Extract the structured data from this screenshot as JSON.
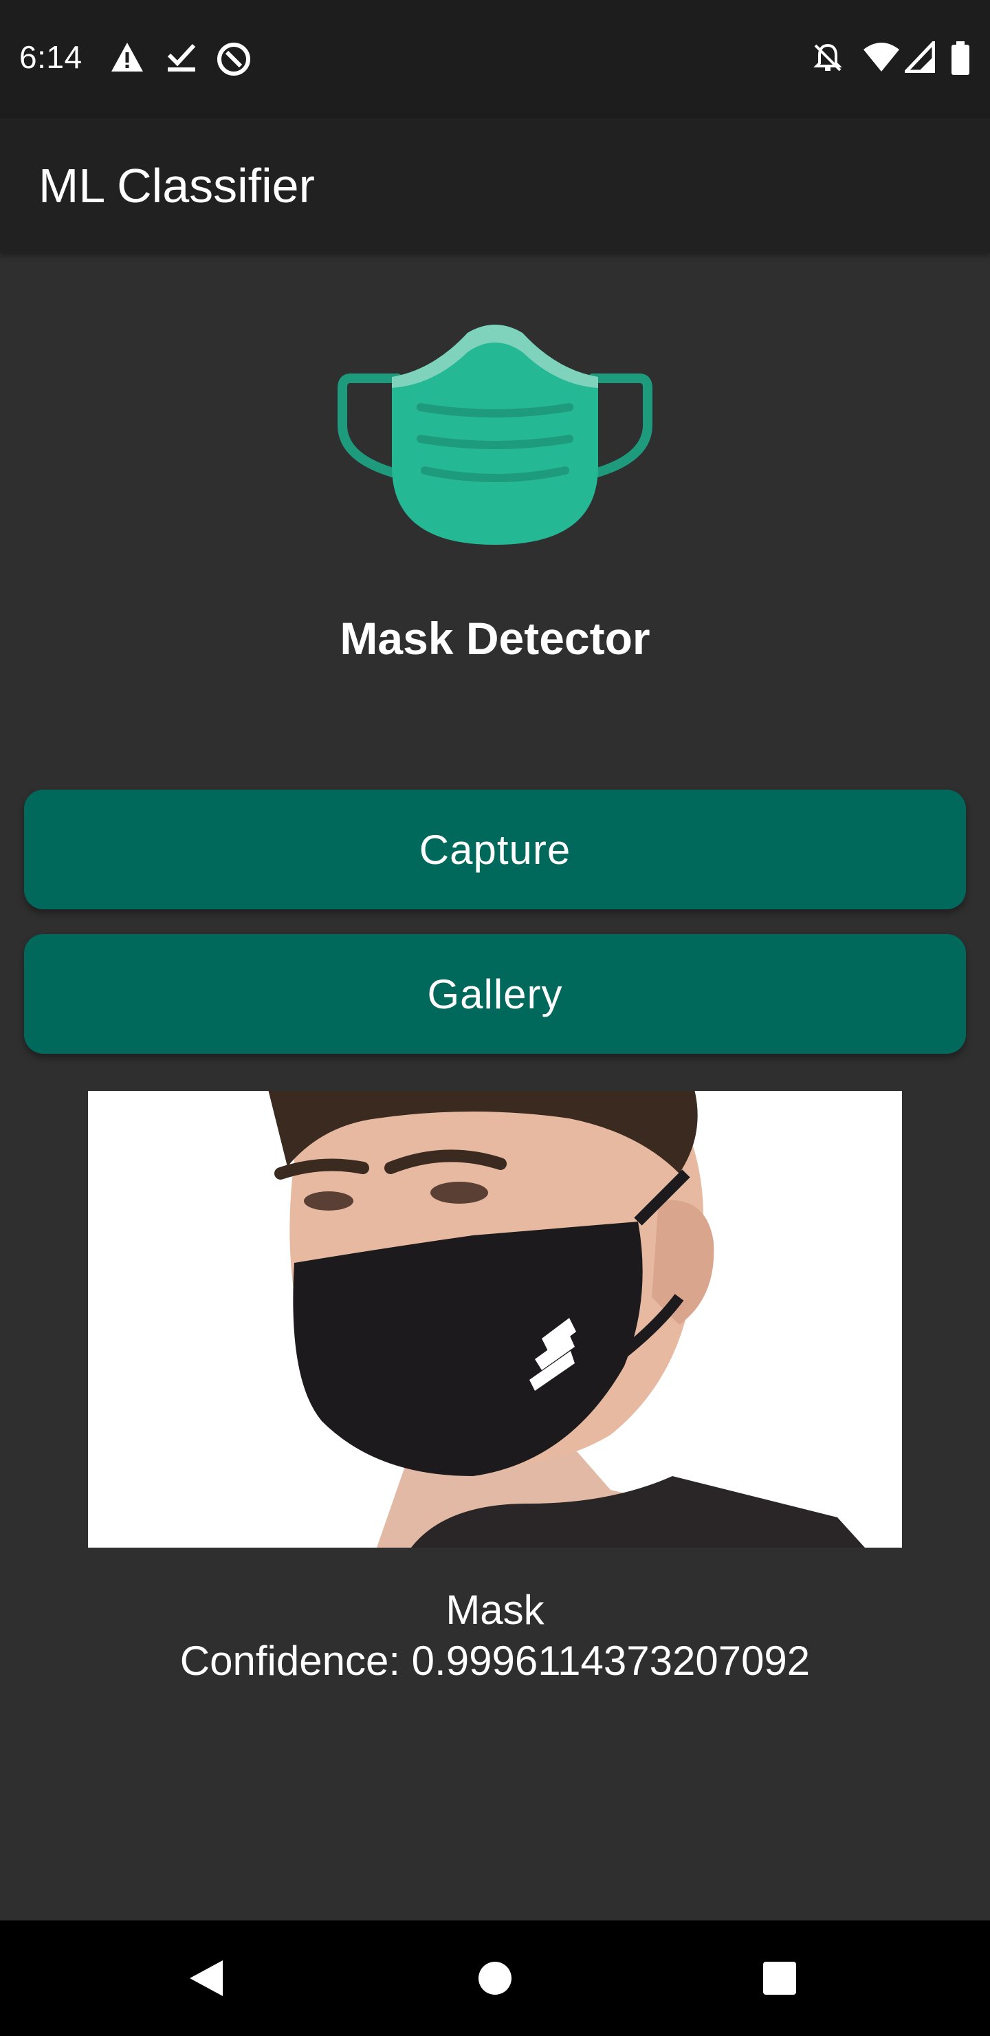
{
  "status_bar": {
    "time": "6:14",
    "left_icons": [
      "warning-icon",
      "check-icon",
      "data-saver-icon"
    ],
    "right_icons": [
      "notifications-off-icon",
      "wifi-icon",
      "signal-icon",
      "battery-icon"
    ]
  },
  "app_bar": {
    "title": "ML Classifier"
  },
  "main": {
    "logo_icon": "face-mask-icon",
    "heading": "Mask Detector",
    "capture_label": "Capture",
    "gallery_label": "Gallery",
    "result_label": "Mask",
    "result_confidence": "Confidence: 0.9996114373207092"
  },
  "nav_bar": {
    "icons": [
      "back-icon",
      "home-icon",
      "recents-icon"
    ]
  },
  "colors": {
    "status_bar": "#1d1d1d",
    "app_bar": "#212121",
    "background": "#2f2f2f",
    "button": "#00695c",
    "mask_primary": "#25b894",
    "mask_dark": "#1e9a7c",
    "mask_light": "#7fd3bd"
  }
}
